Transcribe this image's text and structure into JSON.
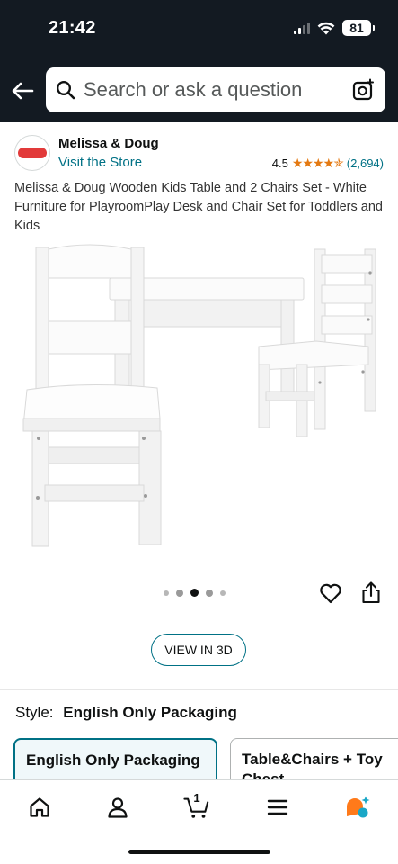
{
  "status_bar": {
    "time": "21:42",
    "battery": "81"
  },
  "search": {
    "placeholder": "Search or ask a question"
  },
  "brand": {
    "name": "Melissa & Doug",
    "visit_store": "Visit the Store",
    "rating_value": "4.5",
    "stars": "★★★★✯",
    "rating_count": "(2,694)"
  },
  "product": {
    "title": "Melissa & Doug Wooden Kids Table and 2 Chairs Set - White Furniture for PlayroomPlay Desk and Chair Set for Toddlers and Kids"
  },
  "carousel": {
    "total_dots": 5,
    "active_index": 2
  },
  "view_3d": {
    "label": "VIEW IN 3D"
  },
  "style": {
    "label": "Style:",
    "value": "English Only Packaging",
    "options": [
      "English Only Packaging",
      "Table&Chairs + Toy Chest"
    ]
  },
  "bottom_nav": {
    "items": [
      "home-icon",
      "person-icon",
      "cart-icon",
      "menu-icon",
      "rufus-icon"
    ],
    "cart_count": "1"
  },
  "colors": {
    "header_bg": "#131a22",
    "link": "#007185",
    "star": "#e47911",
    "selected_border": "#007185"
  }
}
